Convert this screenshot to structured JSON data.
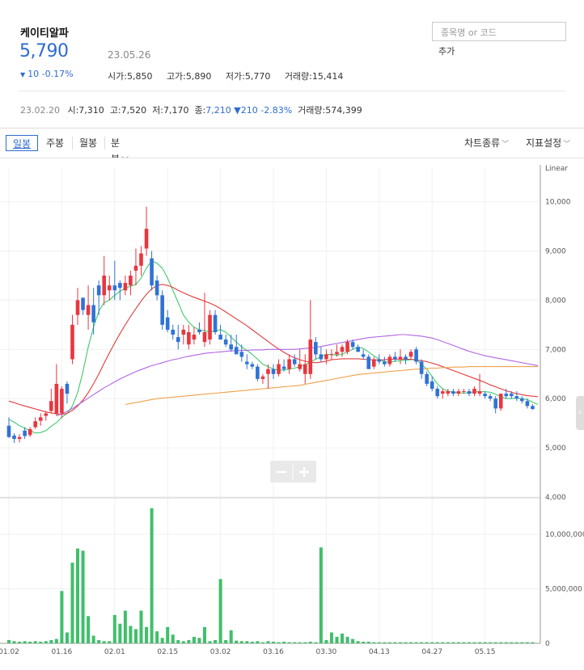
{
  "stock": {
    "name": "케이티알파",
    "price": "5,790",
    "date": "23.05.26",
    "change": "10 -0.17%",
    "change_arrow": "▼",
    "open": "시가:5,850",
    "high": "고가:5,890",
    "low": "저가:5,770",
    "volume": "거래량:15,414"
  },
  "search": {
    "placeholder": "종목명 or 코드",
    "add_label": "추가"
  },
  "prev_day": {
    "date": "23.02.20",
    "open": "시:7,310",
    "high": "고:7,520",
    "low": "저:7,170",
    "close_label": "종:",
    "close": "7,210",
    "change": "▼210 -2.83%",
    "volume": "거래량:574,399"
  },
  "toolbar": {
    "tabs": [
      "일봉",
      "주봉",
      "월봉",
      "분봉"
    ],
    "active_tab": "일봉",
    "chart_type": "차트종류",
    "indicator": "지표설정"
  },
  "colors": {
    "up": "#e8363f",
    "down": "#2f72d6",
    "volume": "#3fbf6a",
    "ma5": "#3ecb6a",
    "ma20": "#e23a3a",
    "ma60": "#b166e6",
    "ma120": "#f0a04a"
  },
  "chart_data": {
    "type": "candlestick",
    "scale_label": "Linear",
    "price_ticks": [
      4000,
      5000,
      6000,
      7000,
      8000,
      9000,
      10000
    ],
    "price_tick_labels": [
      "4,000",
      "5,000",
      "6,000",
      "7,000",
      "8,000",
      "9,000",
      "10,000"
    ],
    "ylim_price": [
      4000,
      10700
    ],
    "volume_ticks": [
      0,
      5000000,
      10000000
    ],
    "volume_tick_labels": [
      "0",
      "5,000,000",
      "10,000,000"
    ],
    "ylim_volume": [
      0,
      13200000
    ],
    "x_labels": [
      {
        "label": "01.02",
        "idx": 0
      },
      {
        "label": "01.16",
        "idx": 10
      },
      {
        "label": "02.01",
        "idx": 20
      },
      {
        "label": "02.15",
        "idx": 30
      },
      {
        "label": "03.02",
        "idx": 40
      },
      {
        "label": "03.16",
        "idx": 50
      },
      {
        "label": "03.30",
        "idx": 60
      },
      {
        "label": "04.13",
        "idx": 70
      },
      {
        "label": "04.27",
        "idx": 80
      },
      {
        "label": "05.15",
        "idx": 90
      }
    ],
    "candles": [
      {
        "o": 5450,
        "h": 5620,
        "l": 5200,
        "c": 5220
      },
      {
        "o": 5250,
        "h": 5300,
        "l": 5100,
        "c": 5180
      },
      {
        "o": 5180,
        "h": 5280,
        "l": 5110,
        "c": 5220
      },
      {
        "o": 5350,
        "h": 5420,
        "l": 5180,
        "c": 5240
      },
      {
        "o": 5260,
        "h": 5420,
        "l": 5220,
        "c": 5380
      },
      {
        "o": 5420,
        "h": 5620,
        "l": 5380,
        "c": 5540
      },
      {
        "o": 5550,
        "h": 5700,
        "l": 5450,
        "c": 5620
      },
      {
        "o": 5650,
        "h": 5750,
        "l": 5550,
        "c": 5700
      },
      {
        "o": 5750,
        "h": 6200,
        "l": 5700,
        "c": 5950
      },
      {
        "o": 5700,
        "h": 6700,
        "l": 5650,
        "c": 6300
      },
      {
        "o": 5700,
        "h": 6250,
        "l": 5600,
        "c": 6200
      },
      {
        "o": 6300,
        "h": 6350,
        "l": 5900,
        "c": 6100
      },
      {
        "o": 6800,
        "h": 7700,
        "l": 6700,
        "c": 7500
      },
      {
        "o": 7700,
        "h": 8250,
        "l": 7500,
        "c": 8000
      },
      {
        "o": 8050,
        "h": 8050,
        "l": 7700,
        "c": 7800
      },
      {
        "o": 7700,
        "h": 8300,
        "l": 7400,
        "c": 7900
      },
      {
        "o": 7900,
        "h": 8250,
        "l": 7300,
        "c": 7550
      },
      {
        "o": 8300,
        "h": 8400,
        "l": 7700,
        "c": 8100
      },
      {
        "o": 8100,
        "h": 8900,
        "l": 7900,
        "c": 8500
      },
      {
        "o": 8200,
        "h": 8500,
        "l": 8000,
        "c": 8300
      },
      {
        "o": 8300,
        "h": 8800,
        "l": 8000,
        "c": 8200
      },
      {
        "o": 8350,
        "h": 8400,
        "l": 8000,
        "c": 8250
      },
      {
        "o": 8200,
        "h": 8500,
        "l": 8100,
        "c": 8350
      },
      {
        "o": 8300,
        "h": 8600,
        "l": 8100,
        "c": 8500
      },
      {
        "o": 8600,
        "h": 9050,
        "l": 8300,
        "c": 8700
      },
      {
        "o": 8700,
        "h": 9100,
        "l": 8500,
        "c": 8950
      },
      {
        "o": 9050,
        "h": 9900,
        "l": 8900,
        "c": 9450
      },
      {
        "o": 8850,
        "h": 9000,
        "l": 8200,
        "c": 8300
      },
      {
        "o": 8400,
        "h": 8500,
        "l": 8000,
        "c": 8100
      },
      {
        "o": 8100,
        "h": 8200,
        "l": 7400,
        "c": 7500
      },
      {
        "o": 7650,
        "h": 7800,
        "l": 7350,
        "c": 7400
      },
      {
        "o": 7400,
        "h": 7500,
        "l": 7200,
        "c": 7300
      },
      {
        "o": 7250,
        "h": 7500,
        "l": 7000,
        "c": 7150
      },
      {
        "o": 7300,
        "h": 7500,
        "l": 7100,
        "c": 7400
      },
      {
        "o": 7100,
        "h": 7500,
        "l": 7000,
        "c": 7350
      },
      {
        "o": 7200,
        "h": 7450,
        "l": 7100,
        "c": 7300
      },
      {
        "o": 7400,
        "h": 7550,
        "l": 7300,
        "c": 7350
      },
      {
        "o": 7150,
        "h": 8150,
        "l": 7050,
        "c": 7350
      },
      {
        "o": 7200,
        "h": 7800,
        "l": 7100,
        "c": 7700
      },
      {
        "o": 7700,
        "h": 7800,
        "l": 7300,
        "c": 7350
      },
      {
        "o": 7300,
        "h": 7500,
        "l": 7200,
        "c": 7200
      },
      {
        "o": 7200,
        "h": 7300,
        "l": 7050,
        "c": 7100
      },
      {
        "o": 7100,
        "h": 7300,
        "l": 6950,
        "c": 7000
      },
      {
        "o": 7050,
        "h": 7300,
        "l": 6950,
        "c": 6900
      },
      {
        "o": 6950,
        "h": 7100,
        "l": 6750,
        "c": 6850
      },
      {
        "o": 6750,
        "h": 6900,
        "l": 6600,
        "c": 6700
      },
      {
        "o": 6700,
        "h": 6750,
        "l": 6600,
        "c": 6650
      },
      {
        "o": 6650,
        "h": 6700,
        "l": 6350,
        "c": 6400
      },
      {
        "o": 6400,
        "h": 6500,
        "l": 6300,
        "c": 6450
      },
      {
        "o": 6500,
        "h": 6700,
        "l": 6200,
        "c": 6600
      },
      {
        "o": 6600,
        "h": 6700,
        "l": 6400,
        "c": 6500
      },
      {
        "o": 6500,
        "h": 6800,
        "l": 6450,
        "c": 6700
      },
      {
        "o": 6650,
        "h": 6800,
        "l": 6550,
        "c": 6600
      },
      {
        "o": 6600,
        "h": 6900,
        "l": 6500,
        "c": 6800
      },
      {
        "o": 6800,
        "h": 6900,
        "l": 6650,
        "c": 6700
      },
      {
        "o": 6600,
        "h": 7000,
        "l": 6550,
        "c": 6700
      },
      {
        "o": 6500,
        "h": 6900,
        "l": 6300,
        "c": 6700
      },
      {
        "o": 6500,
        "h": 8000,
        "l": 6400,
        "c": 7200
      },
      {
        "o": 7150,
        "h": 7250,
        "l": 6800,
        "c": 6900
      },
      {
        "o": 6900,
        "h": 7050,
        "l": 6750,
        "c": 6800
      },
      {
        "o": 6800,
        "h": 7000,
        "l": 6700,
        "c": 6900
      },
      {
        "o": 6900,
        "h": 7000,
        "l": 6800,
        "c": 6900
      },
      {
        "o": 6900,
        "h": 7100,
        "l": 6850,
        "c": 6950
      },
      {
        "o": 6950,
        "h": 7100,
        "l": 6850,
        "c": 7050
      },
      {
        "o": 6950,
        "h": 7200,
        "l": 6900,
        "c": 7150
      },
      {
        "o": 7150,
        "h": 7200,
        "l": 7000,
        "c": 7050
      },
      {
        "o": 7050,
        "h": 7100,
        "l": 6950,
        "c": 6950
      },
      {
        "o": 6900,
        "h": 7000,
        "l": 6800,
        "c": 6850
      },
      {
        "o": 6850,
        "h": 6900,
        "l": 6600,
        "c": 6600
      },
      {
        "o": 6650,
        "h": 6850,
        "l": 6600,
        "c": 6800
      },
      {
        "o": 6800,
        "h": 6900,
        "l": 6700,
        "c": 6750
      },
      {
        "o": 6750,
        "h": 6850,
        "l": 6650,
        "c": 6700
      },
      {
        "o": 6700,
        "h": 6900,
        "l": 6650,
        "c": 6850
      },
      {
        "o": 6850,
        "h": 6950,
        "l": 6750,
        "c": 6800
      },
      {
        "o": 6800,
        "h": 7000,
        "l": 6700,
        "c": 6850
      },
      {
        "o": 6850,
        "h": 6900,
        "l": 6700,
        "c": 6800
      },
      {
        "o": 6850,
        "h": 7000,
        "l": 6800,
        "c": 6950
      },
      {
        "o": 7000,
        "h": 7050,
        "l": 6700,
        "c": 6750
      },
      {
        "o": 6750,
        "h": 6800,
        "l": 6400,
        "c": 6500
      },
      {
        "o": 6500,
        "h": 6550,
        "l": 6250,
        "c": 6300
      },
      {
        "o": 6350,
        "h": 6450,
        "l": 6150,
        "c": 6200
      },
      {
        "o": 6200,
        "h": 6250,
        "l": 6000,
        "c": 6050
      },
      {
        "o": 6100,
        "h": 6200,
        "l": 6000,
        "c": 6150
      },
      {
        "o": 6100,
        "h": 6200,
        "l": 6050,
        "c": 6150
      },
      {
        "o": 6150,
        "h": 6200,
        "l": 6050,
        "c": 6100
      },
      {
        "o": 6100,
        "h": 6200,
        "l": 6050,
        "c": 6150
      },
      {
        "o": 6150,
        "h": 6200,
        "l": 6100,
        "c": 6150
      },
      {
        "o": 6150,
        "h": 6200,
        "l": 6050,
        "c": 6100
      },
      {
        "o": 6100,
        "h": 6250,
        "l": 6050,
        "c": 6200
      },
      {
        "o": 6100,
        "h": 6500,
        "l": 6050,
        "c": 6150
      },
      {
        "o": 6100,
        "h": 6150,
        "l": 6000,
        "c": 6050
      },
      {
        "o": 6050,
        "h": 6100,
        "l": 5950,
        "c": 6000
      },
      {
        "o": 6000,
        "h": 6050,
        "l": 5700,
        "c": 5800
      },
      {
        "o": 5800,
        "h": 6100,
        "l": 5750,
        "c": 6100
      },
      {
        "o": 6100,
        "h": 6200,
        "l": 6000,
        "c": 6050
      },
      {
        "o": 6100,
        "h": 6150,
        "l": 6000,
        "c": 6050
      },
      {
        "o": 6050,
        "h": 6150,
        "l": 5950,
        "c": 6000
      },
      {
        "o": 6000,
        "h": 6050,
        "l": 5900,
        "c": 5950
      },
      {
        "o": 5950,
        "h": 6000,
        "l": 5800,
        "c": 5850
      },
      {
        "o": 5850,
        "h": 5890,
        "l": 5770,
        "c": 5790
      }
    ],
    "volumes": [
      300000,
      200000,
      150000,
      200000,
      150000,
      200000,
      150000,
      200000,
      300000,
      400000,
      4800000,
      1000000,
      7400000,
      8700000,
      8500000,
      2500000,
      700000,
      300000,
      200000,
      200000,
      2600000,
      1800000,
      3000000,
      1600000,
      1300000,
      3000000,
      1500000,
      12400000,
      1100000,
      500000,
      1500000,
      800000,
      300000,
      200000,
      300000,
      600000,
      500000,
      1500000,
      200000,
      300000,
      5900000,
      300000,
      1200000,
      250000,
      200000,
      200000,
      150000,
      200000,
      100000,
      200000,
      150000,
      100000,
      150000,
      100000,
      100000,
      100000,
      100000,
      150000,
      100000,
      8800000,
      300000,
      1000000,
      600000,
      900000,
      600000,
      400000,
      200000,
      150000,
      150000,
      100000,
      100000,
      100000,
      100000,
      100000,
      100000,
      100000,
      100000,
      100000,
      100000,
      100000,
      100000,
      100000,
      100000,
      100000,
      100000,
      100000,
      100000,
      100000,
      100000,
      100000,
      100000,
      100000,
      100000,
      100000,
      100000,
      100000,
      100000,
      100000,
      100000,
      100000
    ],
    "ma_lines": [
      {
        "color_key": "ma5",
        "start": 0,
        "values": [
          5580,
          5520,
          5450,
          5400,
          5350,
          5300,
          5310,
          5350,
          5440,
          5510,
          5620,
          5700,
          5850,
          6120,
          6550,
          7050,
          7450,
          7780,
          7950,
          8000,
          8100,
          8180,
          8250,
          8280,
          8320,
          8450,
          8650,
          8800,
          8750,
          8650,
          8450,
          8200,
          7950,
          7700,
          7550,
          7450,
          7400,
          7380,
          7350,
          7380,
          7400,
          7350,
          7250,
          7150,
          7050,
          6980,
          6900,
          6800,
          6700,
          6650,
          6600,
          6580,
          6580,
          6600,
          6620,
          6650,
          6680,
          6750,
          6800,
          6850,
          6900,
          6900,
          6880,
          6900,
          6950,
          7000,
          7050,
          7020,
          6950,
          6870,
          6800,
          6750,
          6740,
          6760,
          6770,
          6780,
          6790,
          6800,
          6700,
          6600,
          6450,
          6300,
          6200,
          6150,
          6130,
          6120,
          6110,
          6120,
          6140,
          6140,
          6140,
          6130,
          6090,
          6040,
          6000,
          6000,
          6010,
          6000,
          5980,
          5930,
          5880
        ]
      },
      {
        "color_key": "ma20",
        "start": 0,
        "values": [
          5950,
          5920,
          5880,
          5850,
          5820,
          5790,
          5760,
          5730,
          5710,
          5690,
          5680,
          5700,
          5760,
          5850,
          5970,
          6120,
          6300,
          6500,
          6720,
          6930,
          7130,
          7320,
          7500,
          7670,
          7830,
          7980,
          8120,
          8230,
          8300,
          8320,
          8300,
          8260,
          8200,
          8150,
          8100,
          8060,
          8020,
          7980,
          7940,
          7890,
          7830,
          7760,
          7690,
          7620,
          7550,
          7480,
          7400,
          7320,
          7240,
          7160,
          7080,
          7010,
          6940,
          6880,
          6830,
          6790,
          6760,
          6740,
          6730,
          6740,
          6760,
          6790,
          6800,
          6810,
          6810,
          6810,
          6810,
          6800,
          6790,
          6790,
          6780,
          6790,
          6800,
          6800,
          6800,
          6800,
          6800,
          6780,
          6770,
          6750,
          6720,
          6690,
          6650,
          6610,
          6570,
          6530,
          6490,
          6450,
          6410,
          6370,
          6330,
          6280,
          6240,
          6200,
          6160,
          6130,
          6100,
          6080,
          6060,
          6050,
          6040
        ]
      },
      {
        "color_key": "ma60",
        "start": 9,
        "values": [
          5650,
          5690,
          5740,
          5800,
          5870,
          5940,
          6010,
          6080,
          6150,
          6220,
          6280,
          6340,
          6400,
          6450,
          6500,
          6550,
          6590,
          6630,
          6670,
          6700,
          6730,
          6760,
          6790,
          6810,
          6840,
          6860,
          6880,
          6900,
          6920,
          6930,
          6940,
          6950,
          6960,
          6970,
          6970,
          6980,
          6980,
          6990,
          6990,
          6990,
          7000,
          7000,
          7000,
          7000,
          7000,
          7000,
          7010,
          7020,
          7030,
          7040,
          7060,
          7080,
          7100,
          7120,
          7140,
          7160,
          7180,
          7200,
          7220,
          7240,
          7250,
          7260,
          7270,
          7280,
          7290,
          7300,
          7300,
          7290,
          7280,
          7270,
          7250,
          7230,
          7200,
          7160,
          7120,
          7080,
          7040,
          7000,
          6960,
          6930,
          6900,
          6870,
          6850,
          6830,
          6810,
          6790,
          6770,
          6750,
          6730,
          6710,
          6690,
          6670
        ]
      },
      {
        "color_key": "ma120",
        "start": 22,
        "values": [
          5880,
          5900,
          5920,
          5940,
          5960,
          5980,
          6000,
          6010,
          6020,
          6030,
          6040,
          6050,
          6060,
          6070,
          6080,
          6090,
          6100,
          6110,
          6120,
          6130,
          6140,
          6150,
          6160,
          6170,
          6180,
          6190,
          6200,
          6210,
          6220,
          6230,
          6240,
          6250,
          6260,
          6270,
          6290,
          6310,
          6330,
          6350,
          6370,
          6390,
          6410,
          6430,
          6450,
          6470,
          6490,
          6500,
          6510,
          6520,
          6530,
          6540,
          6550,
          6560,
          6570,
          6580,
          6590,
          6600,
          6600,
          6610,
          6620,
          6620,
          6630,
          6630,
          6640,
          6640,
          6640,
          6650,
          6650,
          6650,
          6650,
          6650,
          6650,
          6650,
          6650,
          6650,
          6650,
          6650,
          6650,
          6650,
          6650
        ]
      }
    ],
    "title": "",
    "xlabel": "",
    "ylabel": ""
  }
}
